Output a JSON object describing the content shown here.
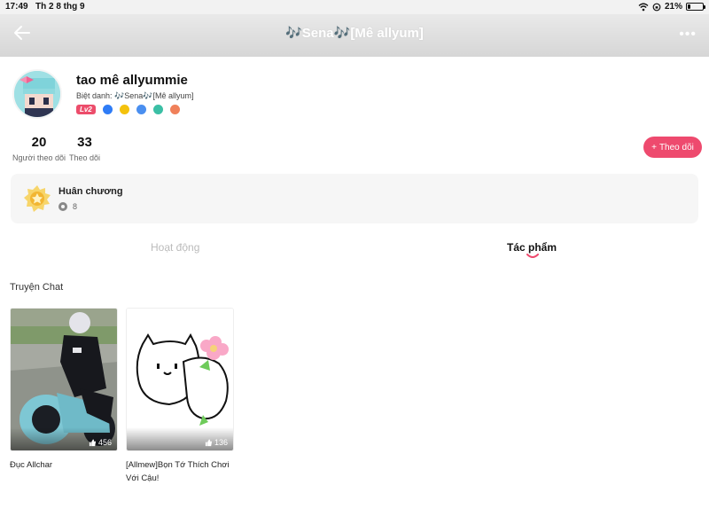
{
  "statusbar": {
    "time": "17:49",
    "date": "Th 2 8 thg 9",
    "battery": "21%",
    "battery_level": 0.21
  },
  "header": {
    "title": "🎶Sena🎶[Mê allyum]",
    "more": "•••"
  },
  "profile": {
    "name": "tao mê allyummie",
    "nickname": "Biệt danh: 🎶Sena🎶[Mê allyum]",
    "level": "Lv2",
    "badge_colors": [
      "#2f7cf6",
      "#f4c20d",
      "#4a8ff0",
      "#3bbfa5",
      "#f0805a"
    ]
  },
  "stats": {
    "followers": {
      "count": "20",
      "label": "Người theo dõi"
    },
    "following": {
      "count": "33",
      "label": "Theo dõi"
    }
  },
  "follow_button": {
    "label": "Theo dõi"
  },
  "medals": {
    "title": "Huân chương",
    "count": "8"
  },
  "tabs": [
    {
      "label": "Hoạt động"
    },
    {
      "label": "Tác phẩm"
    }
  ],
  "section": {
    "title": "Truyện Chat"
  },
  "posts": [
    {
      "title": "Đục Allchar",
      "likes": "456"
    },
    {
      "title": "[Allmew]Bọn Tớ Thích Chơi Với Cậu!",
      "likes": "136"
    }
  ],
  "colors": {
    "accent": "#ee4a6e",
    "tab_inactive": "#bbbbbb"
  }
}
